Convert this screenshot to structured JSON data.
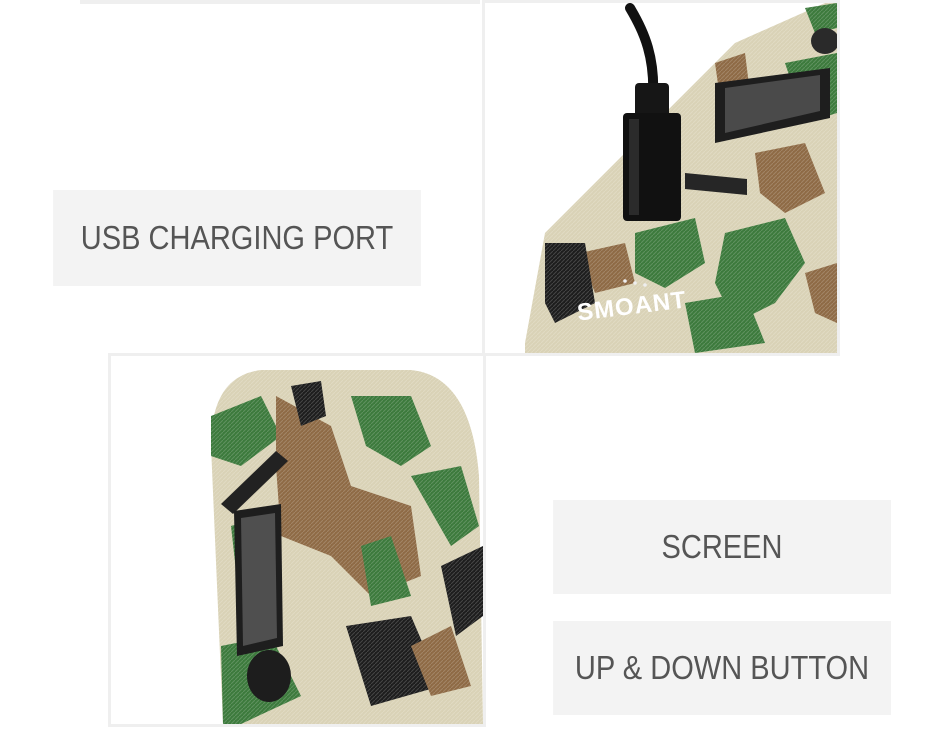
{
  "labels": {
    "usb_port": "USB CHARGING PORT",
    "screen": "SCREEN",
    "buttons": "UP & DOWN BUTTON"
  },
  "device_logo_text": "SMOANT",
  "colors": {
    "label_bg": "#f3f3f3",
    "label_text": "#555555",
    "frame_border": "#efefef",
    "camo_sand": "#d9d2b6",
    "camo_green": "#3c7a3c",
    "camo_brown": "#8e6a45",
    "camo_black": "#1d1d1d"
  },
  "icons": [
    "usb-cable-icon",
    "fire-button-icon",
    "oled-screen-icon",
    "adjust-button-icon"
  ]
}
